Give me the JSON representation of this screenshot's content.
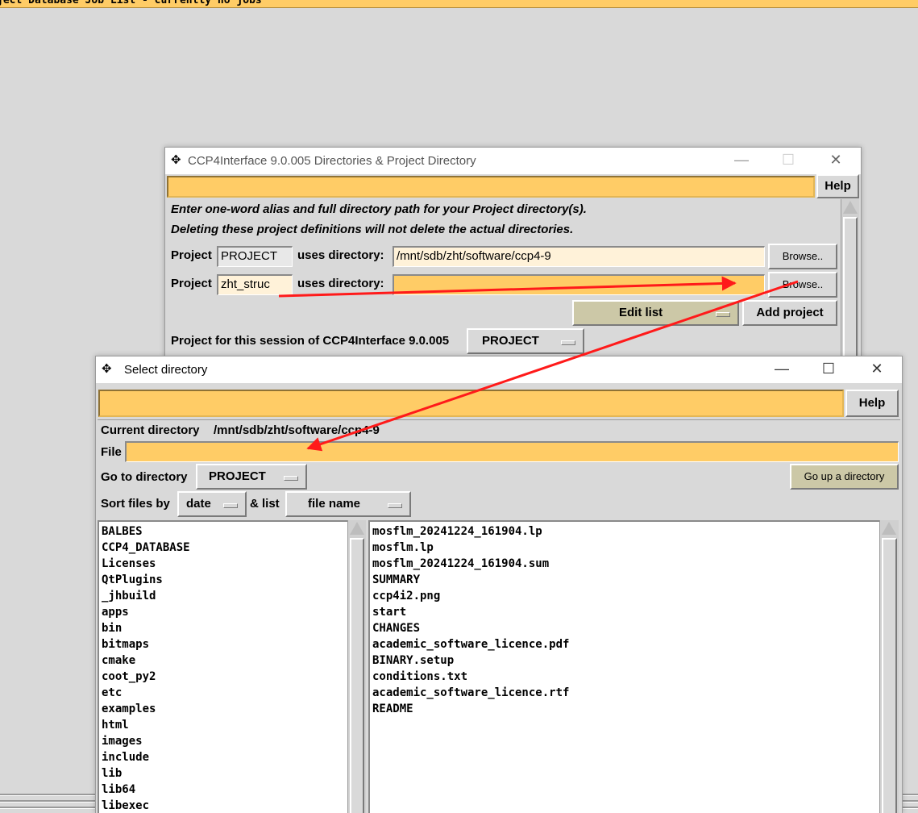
{
  "background": {
    "title": "ject Database Job List - currently no jobs"
  },
  "dirs_window": {
    "title": "CCP4Interface 9.0.005 Directories & Project Directory",
    "help_label": "Help",
    "intro_line1": "Enter one-word alias and full directory path for your Project directory(s).",
    "intro_line2": "Deleting these project definitions will not delete the actual directories.",
    "project_label": "Project",
    "uses_directory_label": "uses directory:",
    "projects": [
      {
        "alias": "PROJECT",
        "directory": "/mnt/sdb/zht/software/ccp4-9",
        "browse_label": "Browse.."
      },
      {
        "alias": "zht_struc",
        "directory": "",
        "browse_label": "Browse.."
      }
    ],
    "edit_list_label": "Edit list",
    "add_project_label": "Add project",
    "session_label": "Project for this session of CCP4Interface 9.0.005",
    "session_value": "PROJECT"
  },
  "select_window": {
    "title": "Select directory",
    "help_label": "Help",
    "current_dir_label": "Current directory",
    "current_dir_value": "/mnt/sdb/zht/software/ccp4-9",
    "file_label": "File",
    "file_value": "",
    "goto_label": "Go to directory",
    "goto_value": "PROJECT",
    "go_up_label": "Go up a directory",
    "sort_label": "Sort files by",
    "sort_value": "date",
    "list_label": "& list",
    "list_value": "file name",
    "directories": [
      "BALBES",
      "CCP4_DATABASE",
      "Licenses",
      "QtPlugins",
      "_jhbuild",
      "apps",
      "bin",
      "bitmaps",
      "cmake",
      "coot_py2",
      "etc",
      "examples",
      "html",
      "images",
      "include",
      "lib",
      "lib64",
      "libexec"
    ],
    "files": [
      "mosflm_20241224_161904.lp",
      "mosflm.lp",
      "mosflm_20241224_161904.sum",
      "SUMMARY",
      "ccp4i2.png",
      "start",
      "CHANGES",
      "academic_software_licence.pdf",
      "BINARY.setup",
      "conditions.txt",
      "academic_software_licence.rtf",
      "README"
    ]
  },
  "colors": {
    "orange": "#ffcc66",
    "cream": "#fff2d9",
    "annotation_red": "#ff1a1a"
  }
}
